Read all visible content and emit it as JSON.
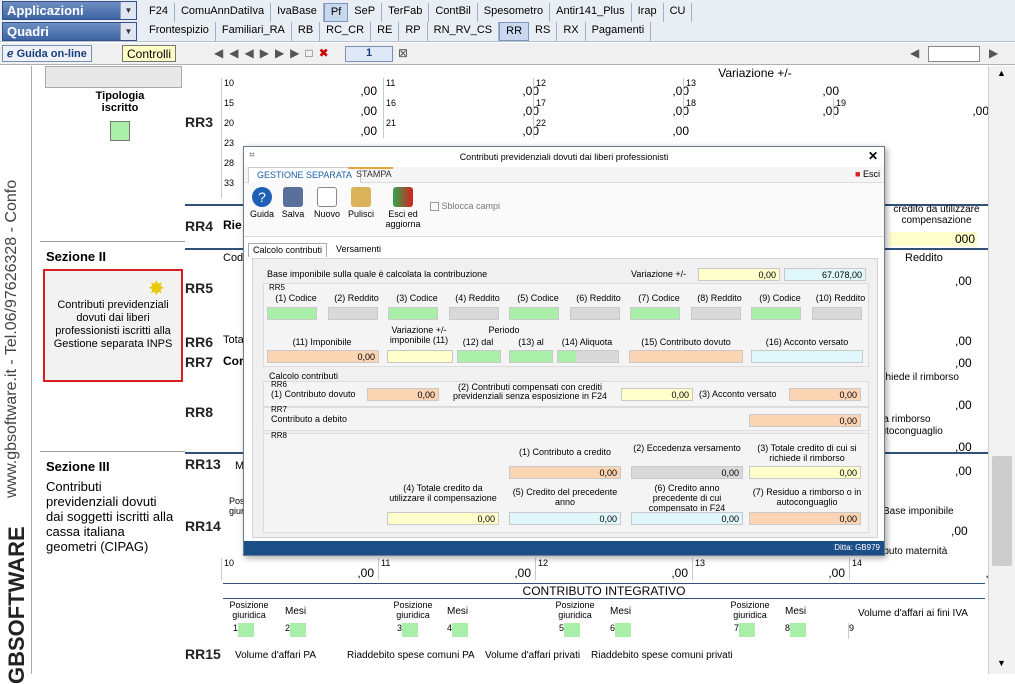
{
  "menu": {
    "applicazioni": "Applicazioni",
    "quadri": "Quadri"
  },
  "tabs_row1": [
    "F24",
    "ComuAnnDatiIva",
    "IvaBase",
    "Pf",
    "SeP",
    "TerFab",
    "ContBil",
    "Spesometro",
    "Antir141_Plus",
    "Irap",
    "CU"
  ],
  "tabs_row2": [
    "Frontespizio",
    "Familiari_RA",
    "RB",
    "RC_CR",
    "RE",
    "RP",
    "RN_RV_CS",
    "RR",
    "RS",
    "RX",
    "Pagamenti"
  ],
  "toolbar": {
    "guide": "Guida on-line",
    "controlli": "Controlli",
    "page": "1"
  },
  "sidebar": {
    "text1": "www.gbsoftware.it - Tel.06/97626328 - Confo",
    "logo": "GBSOFTWARE"
  },
  "left": {
    "tipologia": "Tipologia iscritto",
    "sez2": "Sezione II",
    "sez2_box": "Contributi previdenziali dovuti dai liberi professionisti iscritti alla Gestione separata INPS",
    "sez3": "Sezione III",
    "sez3_text": "Contributi previdenziali dovuti dai soggetti iscritti alla cassa italiana geometri (CIPAG)"
  },
  "form": {
    "rr3": "RR3",
    "rr4": "RR4",
    "rr5": "RR5",
    "rr6": "RR6",
    "rr7": "RR7",
    "rr8": "RR8",
    "rr13": "RR13",
    "rr14": "RR14",
    "rr15": "RR15",
    "variazione": "Variazione +/-",
    "zero": ",00",
    "zero000": "000",
    "reddito": "Reddito",
    "credito_util": "credito da utilizzare",
    "compensazione": "compensazione",
    "richiede_rimborso": "richiede il rimborso",
    "rimborso": "o a rimborso",
    "autoconguaglio": "autoconguaglio",
    "base_imponibile": "Base imponibile",
    "contributo_maternita": "tributo maternità",
    "contributo_integrativo": "CONTRIBUTO INTEGRATIVO",
    "pos_giur": "Posizione giuridica",
    "mesi": "Mesi",
    "volume_iva": "Volume d'affari ai fini IVA",
    "vol_pa": "Volume d'affari PA",
    "riadd_pa": "Riaddebito spese comuni PA",
    "vol_priv": "Volume d'affari privati",
    "riadd_priv": "Riaddebito spese comuni privati",
    "ries": "Rie",
    "tota": "Tota",
    "con": "Con",
    "cod": "Cod",
    "pos": "Posi",
    "giur": "giuri",
    "m": "M"
  },
  "modal": {
    "title": "Contributi previdenziali dovuti dai liberi professionisti",
    "tab_gest": "GESTIONE SEPARATA",
    "tab_stampa": "STAMPA",
    "esci": "Esci",
    "btn": {
      "guida": "Guida",
      "salva": "Salva",
      "nuovo": "Nuovo",
      "pulisci": "Pulisci",
      "esci_agg": "Esci ed aggiorna",
      "sblocca": "Sblocca campi"
    },
    "inner_tabs": {
      "calcolo": "Calcolo contributi",
      "versamenti": "Versamenti"
    },
    "base_label": "Base imponibile sulla quale è calcolata la contribuzione",
    "var_label": "Variazione +/-",
    "var_val": "0,00",
    "base_val": "67.078,00",
    "rr5": "RR5",
    "c1": "(1) Codice",
    "c2": "(2) Reddito",
    "c3": "(3) Codice",
    "c4": "(4) Reddito",
    "c5": "(5) Codice",
    "c6": "(6) Reddito",
    "c7": "(7) Codice",
    "c8": "(8) Reddito",
    "c9": "(9) Codice",
    "c10": "(10) Reddito",
    "c11": "(11) Imponibile",
    "cvar": "Variazione +/- imponibile (11)",
    "periodo": "Periodo",
    "c12": "(12) dal",
    "c13": "(13) al",
    "c14": "(14) Aliquota",
    "c15": "(15) Contributo dovuto",
    "c16": "(16) Acconto versato",
    "imp_val": "0,00",
    "calcolo": "Calcolo contributi",
    "rr6": "RR6",
    "rr6_1": "(1) Contributo dovuto",
    "rr6_1v": "0,00",
    "rr6_2": "(2) Contributi compensati con crediti previdenziali senza esposizione in F24",
    "rr6_2v": "0,00",
    "rr6_3": "(3) Acconto versato",
    "rr6_3v": "0,00",
    "rr7": "RR7",
    "rr7_l": "Contributo a debito",
    "rr7_v": "0,00",
    "rr8": "RR8",
    "rr8_1": "(1) Contributo a credito",
    "rr8_1v": "0,00",
    "rr8_2": "(2) Eccedenza versamento",
    "rr8_2v": "0,00",
    "rr8_3": "(3) Totale credito di cui si richiede il rimborso",
    "rr8_3v": "0,00",
    "rr8_4": "(4) Totale credito da utilizzare il compensazione",
    "rr8_4v": "0,00",
    "rr8_5": "(5) Credito del precedente anno",
    "rr8_5v": "0,00",
    "rr8_6": "(6) Credito anno precedente di cui compensato in F24",
    "rr8_6v": "0,00",
    "rr8_7": "(7) Residuo a rimborso o in autoconguaglio",
    "rr8_7v": "0,00",
    "ditta": "Ditta: GB979"
  },
  "colors": {
    "accent": "#3d63a3",
    "red_box": "#d62020"
  }
}
